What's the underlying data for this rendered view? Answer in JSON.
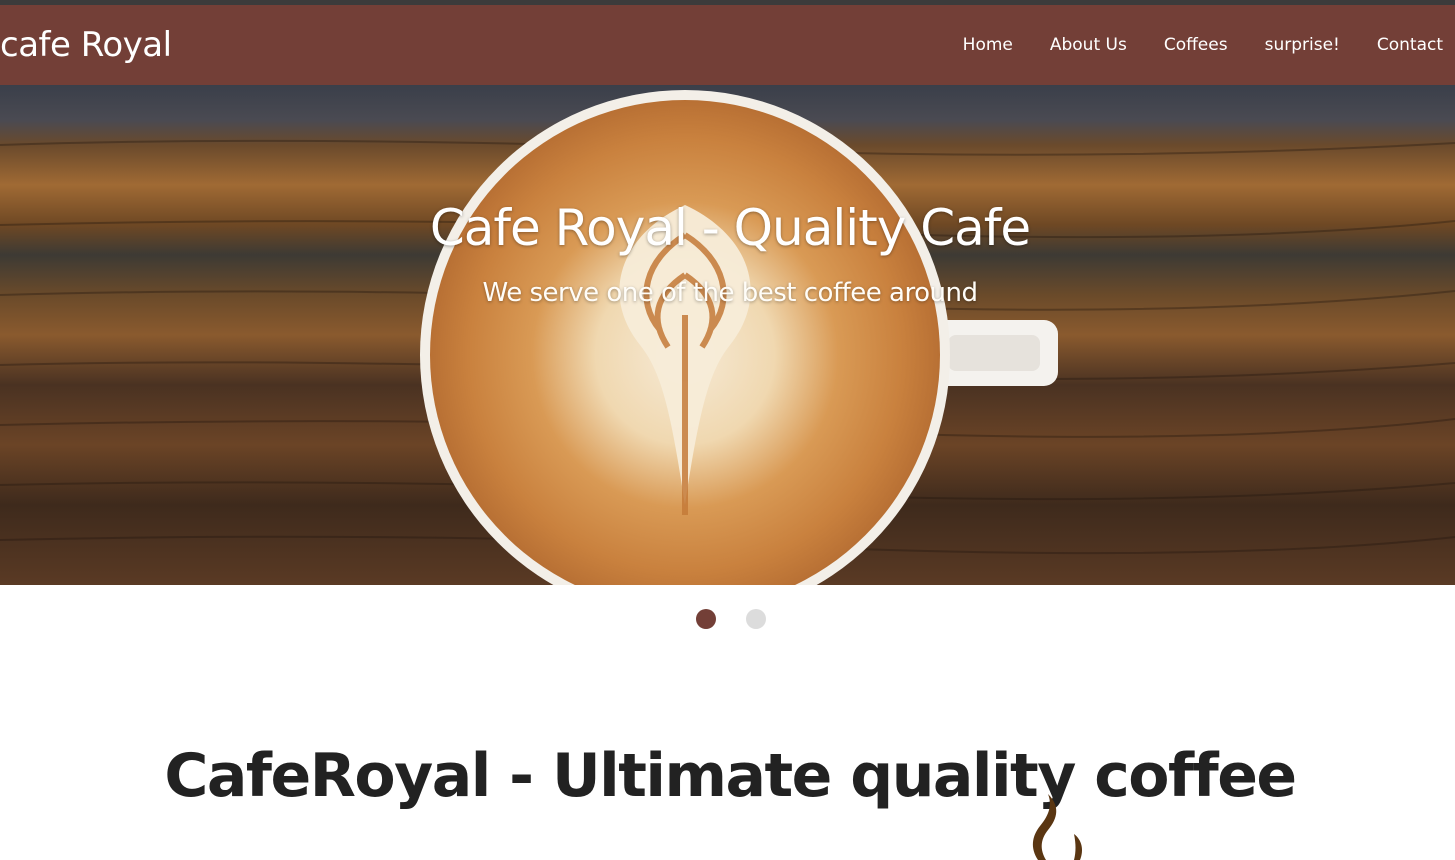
{
  "brand": {
    "name": "cafe Royal"
  },
  "nav": {
    "items": [
      {
        "label": "Home"
      },
      {
        "label": "About Us"
      },
      {
        "label": "Coffees"
      },
      {
        "label": "surprise!"
      },
      {
        "label": "Contact"
      }
    ]
  },
  "hero": {
    "title": "Cafe Royal - Quality Cafe",
    "subtitle": "We serve one of the best coffee around",
    "image": "latte-art-coffee-cup-on-wooden-table"
  },
  "carousel": {
    "slide_count": 2,
    "active_index": 0
  },
  "main": {
    "heading": "CafeRoyal - Ultimate quality coffee",
    "icon": "coffee-steam-icon"
  },
  "colors": {
    "navbar": "#733f37",
    "topline": "#3b3b3b",
    "dot_active": "#733f37",
    "dot_inactive": "#dcdcdc",
    "heading_text": "#222222"
  }
}
